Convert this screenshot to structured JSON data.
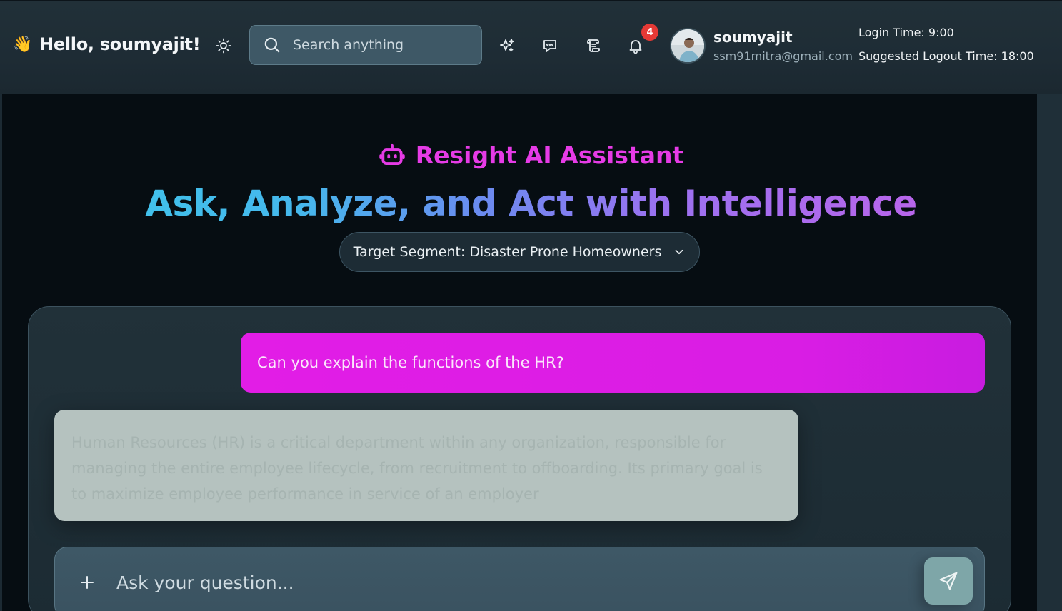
{
  "header": {
    "greeting": "Hello, soumyajit!",
    "greeting_emoji": "👋",
    "search_placeholder": "Search anything",
    "notifications_count": "4",
    "user": {
      "name": "soumyajit",
      "email": "ssm91mitra@gmail.com"
    },
    "login_time": "Login Time: 9:00",
    "logout_time": "Suggested Logout Time: 18:00",
    "icons": [
      "sun-icon",
      "search-icon",
      "sparkles-icon",
      "chat-icon",
      "scroll-icon",
      "bell-icon"
    ]
  },
  "assistant": {
    "title": "Resight AI Assistant",
    "headline": "Ask, Analyze, and Act with Intelligence",
    "segment_label": "Target Segment: Disaster Prone Homeowners"
  },
  "chat": {
    "messages": [
      {
        "role": "user",
        "text": "Can you explain the functions of the HR?"
      },
      {
        "role": "assistant",
        "text": "Human Resources (HR) is a critical department within any organization, responsible for managing the entire employee lifecycle, from recruitment to offboarding. Its primary goal is to maximize employee performance in service of an employer"
      }
    ],
    "input_placeholder": "Ask your question..."
  },
  "colors": {
    "accent_magenta": "#e21de6",
    "title_pink": "#e63be6",
    "gradient_start": "#3ec8ea",
    "gradient_end": "#c95ee8",
    "badge_red": "#e53935"
  }
}
